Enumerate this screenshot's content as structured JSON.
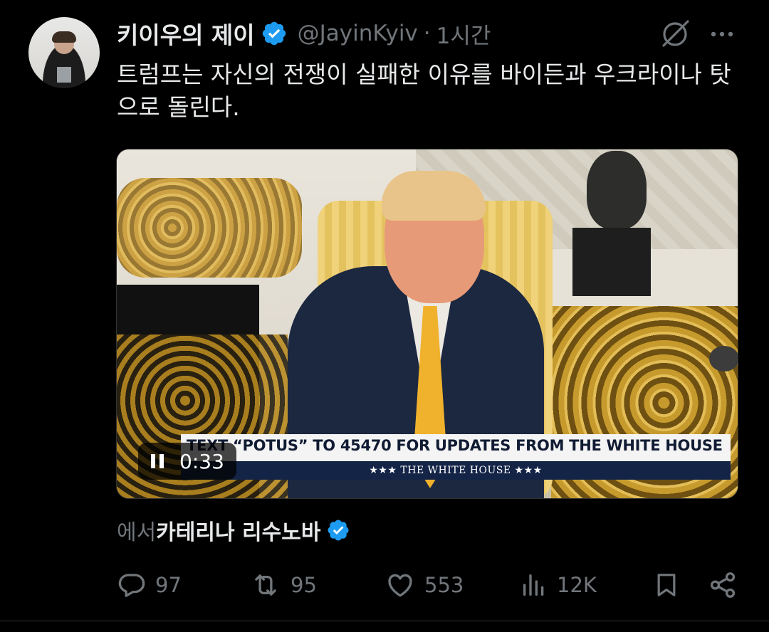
{
  "tweet": {
    "display_name": "키이우의 제이",
    "handle": "@JayinKyiv",
    "separator": "·",
    "time": "1시간",
    "text": "트럼프는 자신의 전쟁이 실패한 이유를 바이든과 우크라이나 탓으로 돌린다."
  },
  "media": {
    "banner_text": "TEXT “POTUS” TO 45470 FOR UPDATES FROM THE WHITE HOUSE",
    "banner_subtext": "★★★  THE WHITE HOUSE  ★★★",
    "video_time": "0:33"
  },
  "attribution": {
    "prefix": "에서",
    "name": "카테리나 리수노바"
  },
  "actions": {
    "replies": "97",
    "reposts": "95",
    "likes": "553",
    "views": "12K"
  },
  "colors": {
    "background": "#000000",
    "text_primary": "#e7e9ea",
    "text_secondary": "#71767b",
    "verified_blue": "#1d9bf0"
  },
  "icons": [
    "verified-badge-icon",
    "grok-icon",
    "more-icon",
    "pause-icon",
    "reply-icon",
    "repost-icon",
    "like-icon",
    "views-icon",
    "bookmark-icon",
    "share-icon"
  ]
}
